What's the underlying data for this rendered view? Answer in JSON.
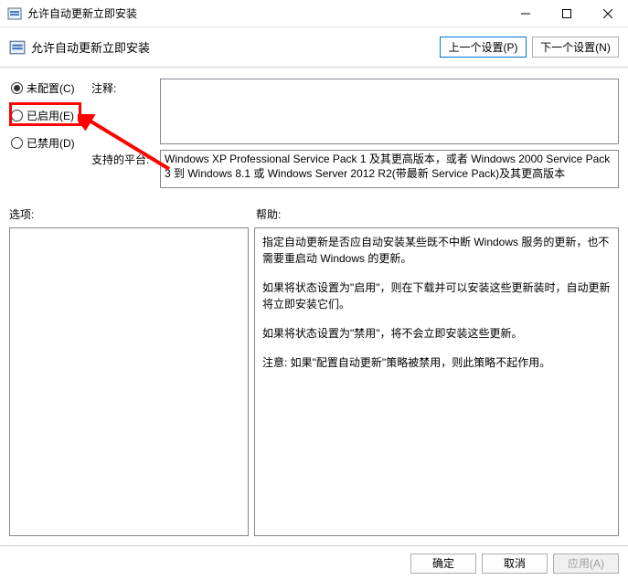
{
  "window": {
    "title": "允许自动更新立即安装"
  },
  "header": {
    "title": "允许自动更新立即安装",
    "prev_button": "上一个设置(P)",
    "next_button": "下一个设置(N)"
  },
  "radios": {
    "not_configured": "未配置(C)",
    "enabled": "已启用(E)",
    "disabled": "已禁用(D)",
    "selected": "not_configured"
  },
  "fields": {
    "comment_label": "注释:",
    "comment_value": "",
    "platform_label": "支持的平台:",
    "platform_value": "Windows XP Professional Service Pack 1 及其更高版本，或者 Windows 2000 Service Pack 3 到 Windows 8.1 或 Windows Server 2012 R2(带最新 Service Pack)及其更高版本"
  },
  "mid": {
    "options_label": "选项:",
    "help_label": "帮助:"
  },
  "help": {
    "p1": "指定自动更新是否应自动安装某些既不中断 Windows 服务的更新，也不需要重启动 Windows 的更新。",
    "p2": "如果将状态设置为\"启用\"，则在下载并可以安装这些更新装时，自动更新将立即安装它们。",
    "p3": "如果将状态设置为\"禁用\"，将不会立即安装这些更新。",
    "p4": "注意: 如果\"配置自动更新\"策略被禁用，则此策略不起作用。"
  },
  "footer": {
    "ok": "确定",
    "cancel": "取消",
    "apply": "应用(A)"
  }
}
